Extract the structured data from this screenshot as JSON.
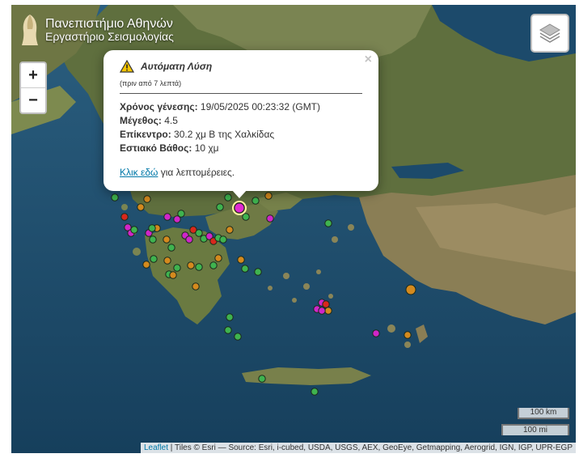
{
  "logo": {
    "line1": "Πανεπιστήμιο Αθηνών",
    "line2": "Εργαστήριο Σεισμολογίας"
  },
  "zoom": {
    "in": "+",
    "out": "−"
  },
  "popup": {
    "close": "×",
    "title": "Αυτόματη Λύση",
    "subtitle": "(πριν από 7 λεπτά)",
    "origin_time_label": "Χρόνος γένεσης:",
    "origin_time_value": "19/05/2025 00:23:32 (GMT)",
    "magnitude_label": "Μέγεθος:",
    "magnitude_value": "4.5",
    "epicenter_label": "Επίκεντρο:",
    "epicenter_value": "30.2 χμ Β της Χαλκίδας",
    "depth_label": "Εστιακό Βάθος:",
    "depth_value": "10 χμ",
    "link_text": "Κλικ εδώ",
    "link_suffix": "για λεπτομέρειες."
  },
  "scale": {
    "km": "100 km",
    "mi": "100 mi"
  },
  "attribution": {
    "leaflet": "Leaflet",
    "text": " | Tiles © Esri — Source: Esri, i-cubed, USDA, USGS, AEX, GeoEye, Getmapping, Aerogrid, IGN, IGP, UPR-EGP"
  },
  "colors": {
    "green": "#3fb34f",
    "magenta": "#d026c9",
    "orange": "#d48a1e",
    "red": "#d9281c",
    "selected": "#e02bd0"
  },
  "icons": {
    "warning": "warning-triangle-icon",
    "layers": "layers-icon",
    "logo": "athena-helmet-icon"
  }
}
